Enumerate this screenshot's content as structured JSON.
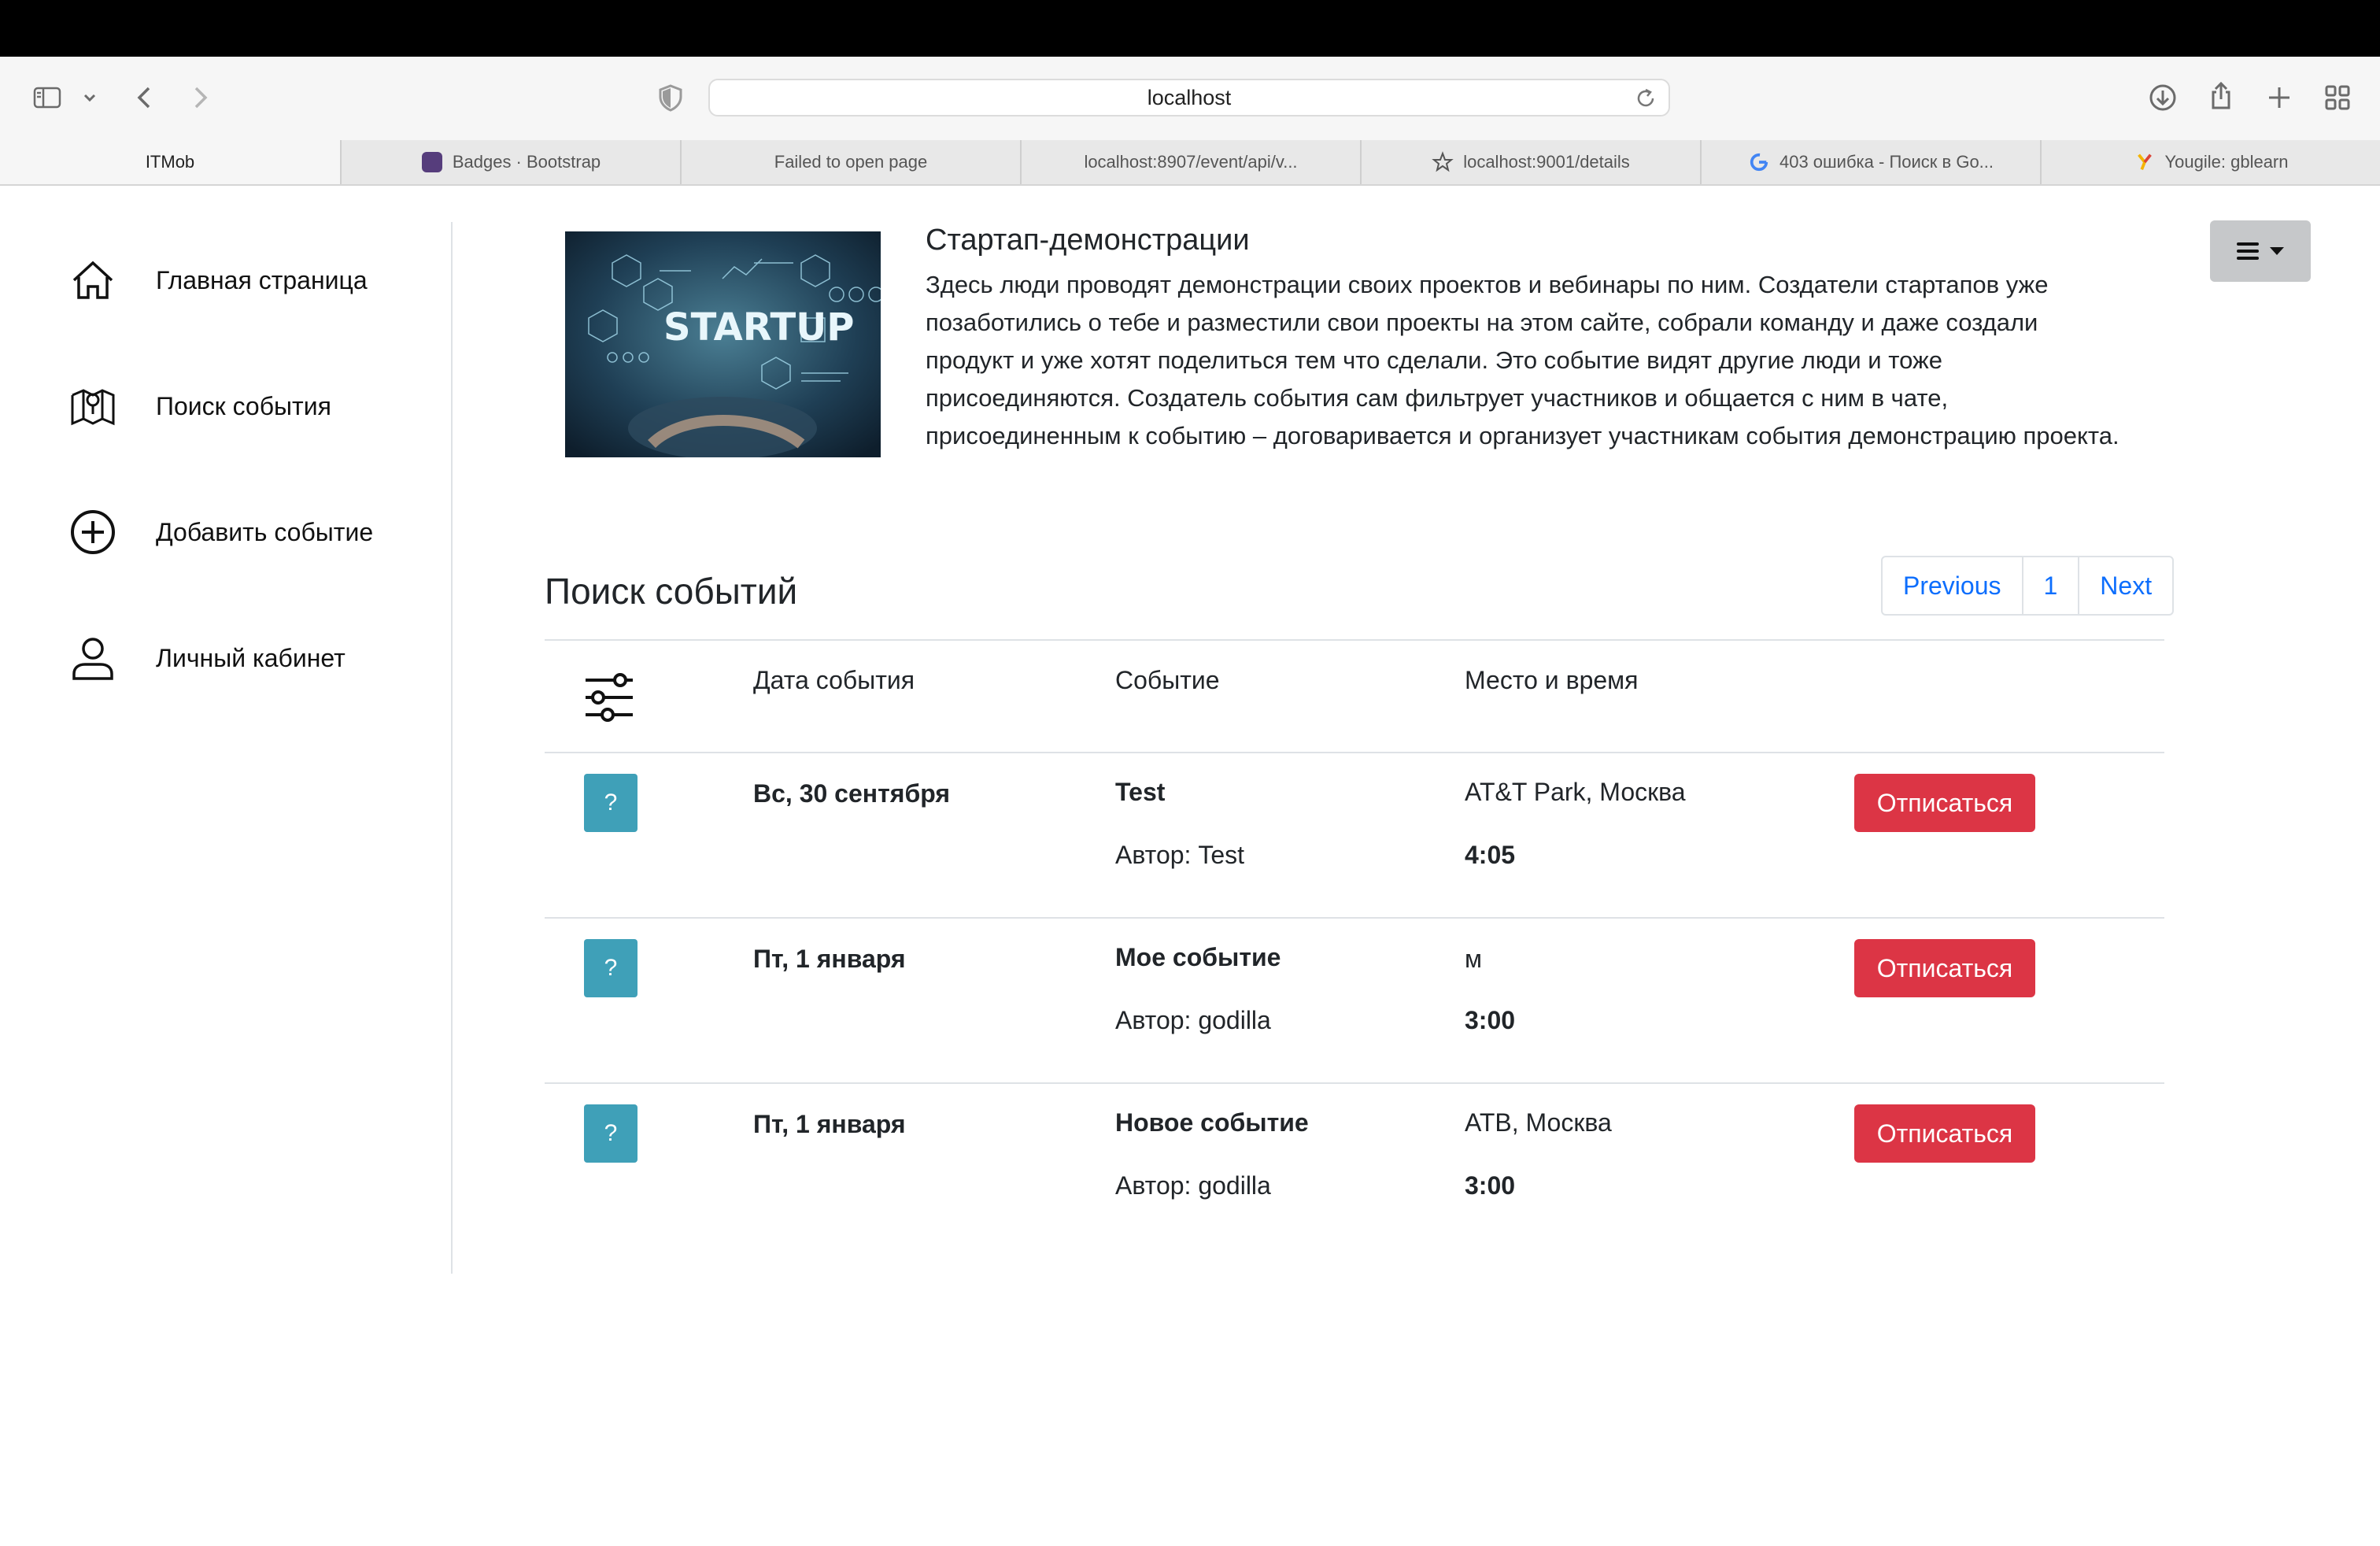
{
  "browser": {
    "url": "localhost",
    "tabs": [
      {
        "label": "ITMob",
        "icon": "none",
        "active": true
      },
      {
        "label": "Badges · Bootstrap",
        "icon": "bootstrap-icon"
      },
      {
        "label": "Failed to open page",
        "icon": "none"
      },
      {
        "label": "localhost:8907/event/api/v...",
        "icon": "none"
      },
      {
        "label": "localhost:9001/details",
        "icon": "star-icon"
      },
      {
        "label": "403 ошибка - Поиск в Go...",
        "icon": "google-icon"
      },
      {
        "label": "Yougile: gblearn",
        "icon": "yougile-icon"
      }
    ]
  },
  "sidebar": {
    "items": [
      {
        "label": "Главная страница",
        "icon": "home-icon"
      },
      {
        "label": "Поиск события",
        "icon": "map-search-icon"
      },
      {
        "label": "Добавить событие",
        "icon": "plus-circle-icon"
      },
      {
        "label": "Личный кабинет",
        "icon": "user-icon"
      }
    ]
  },
  "hero": {
    "image_text": "STARTUP",
    "title": "Стартап-демонстрации",
    "description": "Здесь люди проводят демонстрации своих проектов и вебинары по ним. Создатели стартапов уже позаботились о тебе и разместили свои проекты на этом сайте, собрали команду и даже создали продукт и уже хотят поделиться тем что сделали. Это событие видят другие люди и тоже присоединяются. Создатель события сам фильтрует участников и общается с ним в чате, присоединенным к событию – договаривается и организует участникам события демонстрацию проекта."
  },
  "events": {
    "title": "Поиск событий",
    "pagination": {
      "previous": "Previous",
      "page": "1",
      "next": "Next"
    },
    "headers": {
      "date": "Дата события",
      "event": "Событие",
      "place": "Место и время"
    },
    "rows": [
      {
        "badge": "?",
        "date": "Вс, 30 сентября",
        "name": "Test",
        "author": "Автор: Test",
        "place": "AT&T Park, Москва",
        "time": "4:05",
        "action": "Отписаться"
      },
      {
        "badge": "?",
        "date": "Пт, 1 января",
        "name": "Мое событие",
        "author": "Автор: godilla",
        "place": "м",
        "time": "3:00",
        "action": "Отписаться"
      },
      {
        "badge": "?",
        "date": "Пт, 1 января",
        "name": "Новое событие",
        "author": "Автор: godilla",
        "place": "АТВ, Москва",
        "time": "3:00",
        "action": "Отписаться"
      }
    ]
  },
  "colors": {
    "danger": "#dc3545",
    "info": "#3fa0b8",
    "link": "#0d6efd"
  }
}
